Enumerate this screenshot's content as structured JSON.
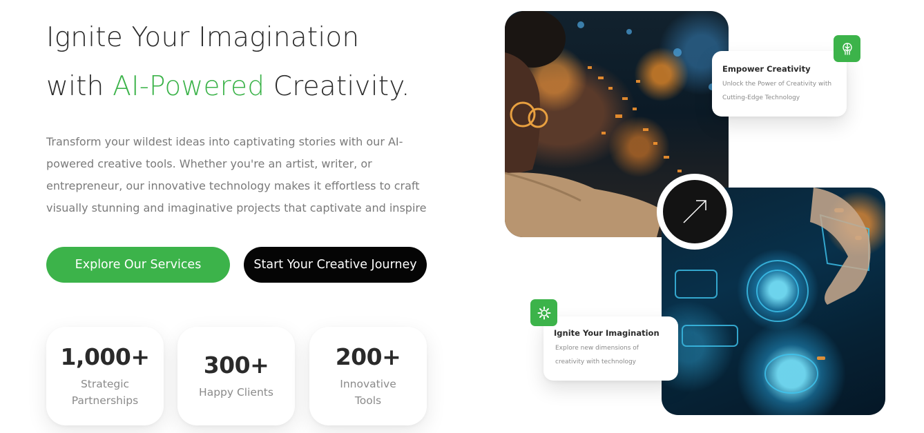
{
  "hero": {
    "title_line1": "Ignite Your Imagination",
    "title_line2_prefix": "with ",
    "title_line2_accent": "AI-Powered",
    "title_line2_suffix": " Creativity.",
    "description": "Transform your wildest ideas into captivating stories with our AI-powered creative tools. Whether you're an artist, writer, or entrepreneur, our innovative technology makes it effortless to craft visually stunning and imaginative projects that captivate and inspire"
  },
  "buttons": {
    "explore": "Explore Our Services",
    "start": "Start Your Creative Journey"
  },
  "stats": [
    {
      "value": "1,000+",
      "label_line1": "Strategic",
      "label_line2": "Partnerships"
    },
    {
      "value": "300+",
      "label_line1": "Happy Clients",
      "label_line2": ""
    },
    {
      "value": "200+",
      "label_line1": "Innovative",
      "label_line2": "Tools"
    }
  ],
  "cards": {
    "empower": {
      "title": "Empower Creativity",
      "desc_line1": "Unlock the Power of Creativity with",
      "desc_line2": "Cutting-Edge Technology",
      "icon": "brain-icon"
    },
    "ignite": {
      "title": "Ignite Your Imagination",
      "desc_line1": "Explore new dimensions of",
      "desc_line2": "creativity with technology",
      "icon": "gear-icon"
    }
  },
  "images": {
    "top": "woman-with-glasses-photo",
    "bottom": "digital-interface-photo"
  },
  "colors": {
    "accent": "#3cb34a",
    "dark": "#050505",
    "text": "#2b2b2b",
    "muted": "#7a7a7a"
  }
}
